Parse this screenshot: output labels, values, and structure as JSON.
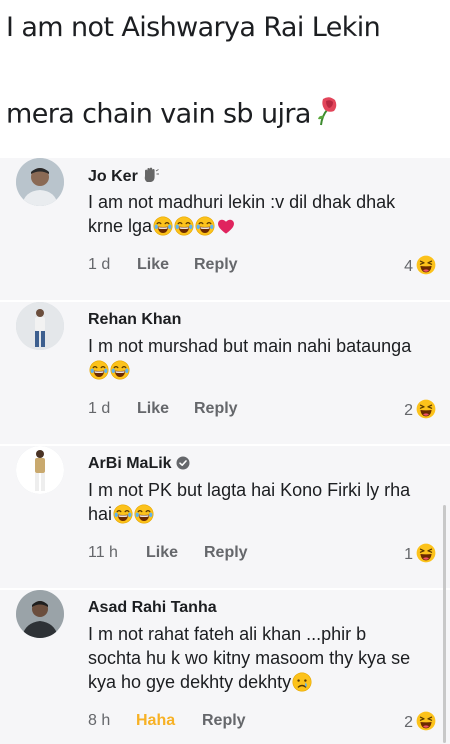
{
  "post": {
    "line1": "I am not Aishwarya Rai Lekin",
    "line2": "mera chain vain sb ujra",
    "line2_icon": "wilted-rose-icon"
  },
  "comments": [
    {
      "name": "Jo Ker",
      "name_badge": "waving-hand-icon",
      "text": "I am not madhuri lekin :v dil dhak dhak krne lga",
      "trailing_emoji": [
        "laughing-face-icon",
        "laughing-face-icon",
        "laughing-face-icon",
        "red-heart-icon"
      ],
      "time": "1 d",
      "react_label": "Like",
      "reply_label": "Reply",
      "reaction_count": "4",
      "reaction_icon": "haha-reaction-icon"
    },
    {
      "name": "Rehan Khan",
      "text": "I m not murshad but main nahi bataunga",
      "trailing_emoji": [
        "laughing-face-icon",
        "laughing-face-icon"
      ],
      "time": "1 d",
      "react_label": "Like",
      "reply_label": "Reply",
      "reaction_count": "2",
      "reaction_icon": "haha-reaction-icon"
    },
    {
      "name": "ArBi MaLik",
      "name_badge": "verified-check-icon",
      "text": "I m not PK but lagta hai Kono Firki ly rha hai",
      "trailing_emoji": [
        "laughing-face-icon",
        "laughing-face-icon"
      ],
      "time": "11 h",
      "react_label": "Like",
      "reply_label": "Reply",
      "reaction_count": "1",
      "reaction_icon": "haha-reaction-icon"
    },
    {
      "name": "Asad Rahi Tanha",
      "text": "I m not rahat fateh ali khan ...phir b sochta hu k wo kitny masoom thy kya se kya ho gye dekhty dekhty",
      "trailing_emoji": [
        "crying-face-icon"
      ],
      "time": "8 h",
      "react_label": "Haha",
      "react_active": true,
      "reply_label": "Reply",
      "reaction_count": "2",
      "reaction_icon": "haha-reaction-icon"
    }
  ],
  "colors": {
    "meta_text": "#65676b",
    "haha_active": "#f7b125",
    "comment_bg": "#f6f6f8",
    "heart": "#e0245e"
  }
}
